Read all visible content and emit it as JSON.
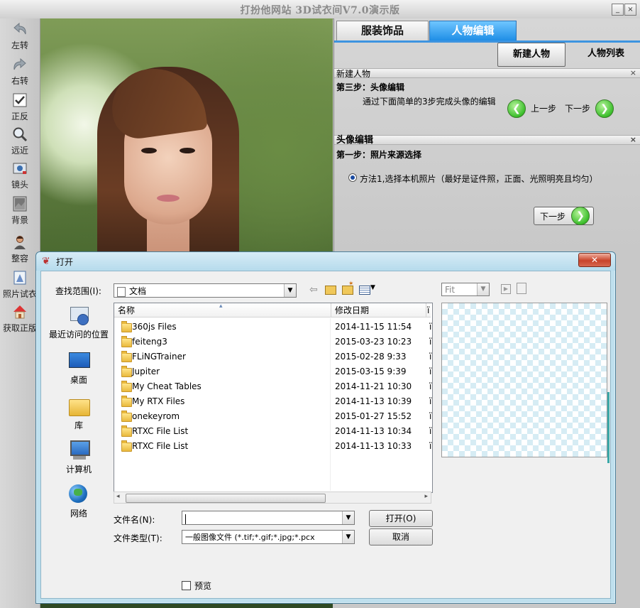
{
  "app": {
    "title": "打扮他网站 3D试衣间V7.0演示版",
    "window_buttons": {
      "minimize": "_",
      "restore": "▫",
      "close": "×"
    }
  },
  "toolbar": {
    "items": [
      {
        "label": "左转",
        "icon": "rotate-left-icon"
      },
      {
        "label": "右转",
        "icon": "rotate-right-icon"
      },
      {
        "label": "正反",
        "icon": "flip-icon"
      },
      {
        "label": "远近",
        "icon": "zoom-icon"
      },
      {
        "label": "镜头",
        "icon": "camera-icon"
      },
      {
        "label": "背景",
        "icon": "background-icon"
      },
      {
        "label": "整容",
        "icon": "face-edit-icon"
      },
      {
        "label": "照片试衣",
        "icon": "photo-tryon-icon"
      },
      {
        "label": "获取正版",
        "icon": "home-icon"
      }
    ]
  },
  "panel": {
    "tabs": [
      {
        "label": "服装饰品"
      },
      {
        "label": "人物编辑",
        "active": true
      }
    ],
    "new_character_button": "新建人物",
    "character_list_button": "人物列表",
    "section1": {
      "header": "新建人物",
      "step_title": "第三步：头像编辑",
      "description": "通过下面简单的3步完成头像的编辑",
      "prev_label": "上一步",
      "next_label": "下一步"
    },
    "section2": {
      "header": "头像编辑",
      "step_title": "第一步：照片来源选择",
      "option_label": "方法1,选择本机照片（最好是证件照，正面、光照明亮且均匀）",
      "next_button": "下一步"
    }
  },
  "dialog": {
    "title": "打开",
    "look_in_label": "查找范围(I):",
    "look_in_value": "文档",
    "places": [
      {
        "label": "最近访问的位置",
        "icon": "recent-places-icon"
      },
      {
        "label": "桌面",
        "icon": "desktop-icon"
      },
      {
        "label": "库",
        "icon": "library-icon"
      },
      {
        "label": "计算机",
        "icon": "computer-icon"
      },
      {
        "label": "网络",
        "icon": "network-icon"
      }
    ],
    "columns": {
      "name": "名称",
      "date": "修改日期",
      "extra": "ï"
    },
    "files": [
      {
        "name": "360js Files",
        "date": "2014-11-15 11:54",
        "extra": "ï"
      },
      {
        "name": "feiteng3",
        "date": "2015-03-23 10:23",
        "extra": "ï"
      },
      {
        "name": "FLiNGTrainer",
        "date": "2015-02-28 9:33",
        "extra": "ï"
      },
      {
        "name": "Jupiter",
        "date": "2015-03-15 9:39",
        "extra": "ï"
      },
      {
        "name": "My Cheat Tables",
        "date": "2014-11-21 10:30",
        "extra": "ï"
      },
      {
        "name": "My RTX Files",
        "date": "2014-11-13 10:39",
        "extra": "ï"
      },
      {
        "name": "onekeyrom",
        "date": "2015-01-27 15:52",
        "extra": "ï"
      },
      {
        "name": "RTXC File List",
        "date": "2014-11-13 10:34",
        "extra": "ï"
      },
      {
        "name": "RTXC File List",
        "date": "2014-11-13 10:33",
        "extra": "ï"
      }
    ],
    "filename_label": "文件名(N):",
    "filename_value": "",
    "filetype_label": "文件类型(T):",
    "filetype_value": "一般图像文件 (*.tif;*.gif;*.jpg;*.pcx",
    "open_button": "打开(O)",
    "cancel_button": "取消",
    "preview_checkbox": "预览",
    "fit_label": "Fit"
  }
}
